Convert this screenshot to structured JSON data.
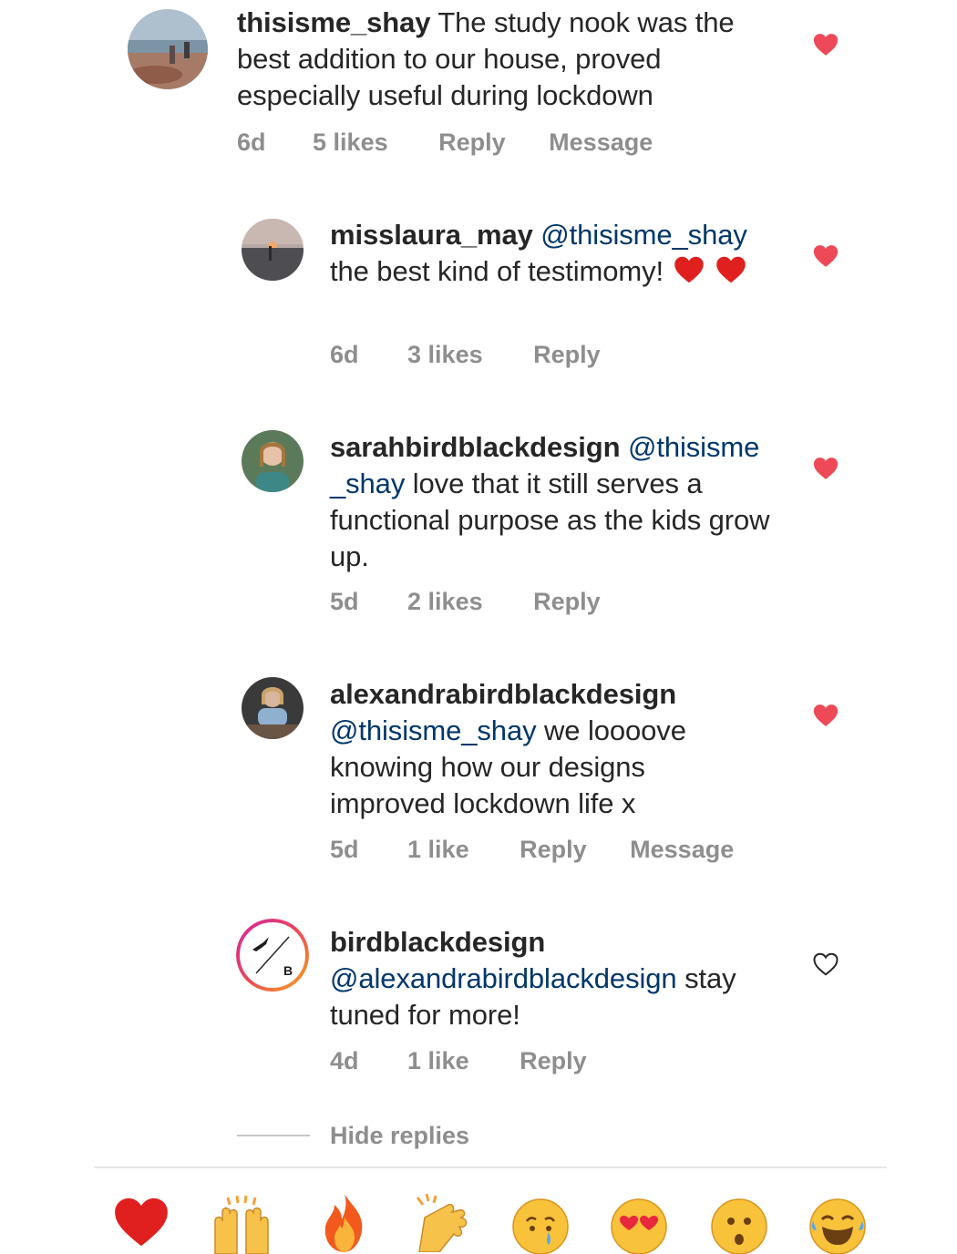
{
  "comments": [
    {
      "username": "thisisme_shay",
      "text": "The study nook was the best addition to our house, proved especially useful during lockdown",
      "time": "6d",
      "likes": "5 likes",
      "reply": "Reply",
      "message": "Message",
      "liked": true
    },
    {
      "username": "misslaura_may",
      "mention": "@thisisme_shay",
      "text": "the best kind of testimomy!",
      "time": "6d",
      "likes": "3 likes",
      "reply": "Reply",
      "liked": true
    },
    {
      "username": "sarahbirdblackdesign",
      "mention_a": "@thisisme",
      "mention_b": "_shay",
      "text": "love that it still serves a functional purpose as the kids grow up.",
      "time": "5d",
      "likes": "2 likes",
      "reply": "Reply",
      "liked": true
    },
    {
      "username": "alexandrabirdblackdesign",
      "mention": "@thisisme_shay",
      "text": "we loooove knowing how our designs improved lockdown life x",
      "time": "5d",
      "likes": "1 like",
      "reply": "Reply",
      "message": "Message",
      "liked": true
    },
    {
      "username": "birdblackdesign",
      "mention": "@alexandrabirdblackdesign",
      "text": "stay tuned for more!",
      "time": "4d",
      "likes": "1 like",
      "reply": "Reply",
      "liked": false,
      "avatar_letter": "B"
    }
  ],
  "hide_replies": "Hide replies",
  "emoji_bar": [
    "heart",
    "raising-hands",
    "fire",
    "clapping-hands",
    "crying-face",
    "heart-eyes-face",
    "surprised-face",
    "tears-of-joy-face"
  ],
  "colors": {
    "heart": "#ed4956",
    "mention": "#00376b",
    "meta": "#8e8e8e"
  }
}
